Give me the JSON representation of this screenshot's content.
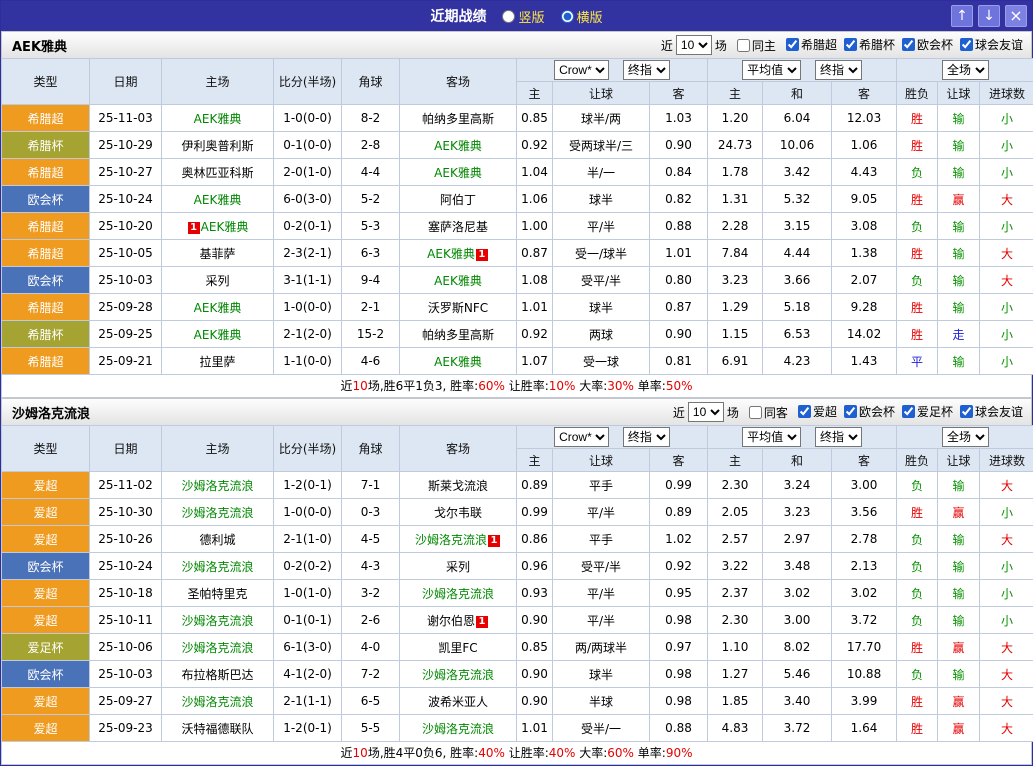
{
  "titlebar": {
    "title": "近期战绩",
    "radios": [
      {
        "label": "竖版",
        "checked": false
      },
      {
        "label": "横版",
        "checked": true
      }
    ],
    "buttons": [
      {
        "name": "up",
        "glyph": "↑"
      },
      {
        "name": "down",
        "glyph": "↓"
      },
      {
        "name": "close",
        "glyph": "×"
      }
    ]
  },
  "filter_labels": {
    "near": "近",
    "field": "场"
  },
  "table_header": {
    "type": "类型",
    "date": "日期",
    "home": "主场",
    "score": "比分(半场)",
    "corner": "角球",
    "away": "客场",
    "dd_crown": "Crow*",
    "dd_final1": "终指",
    "dd_avg": "平均值",
    "dd_final2": "终指",
    "dd_scope": "全场",
    "o1_home": "主",
    "o1_hcp": "让球",
    "o1_away": "客",
    "o2_home": "主",
    "o2_draw": "和",
    "o2_away": "客",
    "result": "胜负",
    "hcp": "让球",
    "goals": "进球数"
  },
  "league_colors": {
    "orange": "#ef9b1f",
    "olive": "#a5a433",
    "blue": "#4a72b8"
  },
  "result_colors": {
    "red": "#e60000",
    "green": "#089000",
    "blue": "#1d1dd8"
  },
  "sections": [
    {
      "team": "AEK雅典",
      "filter": {
        "count": "10",
        "same_label": "同主",
        "leagues": [
          "希腊超",
          "希腊杯",
          "欧会杯",
          "球会友谊"
        ]
      },
      "rows": [
        {
          "league": "希腊超",
          "lc": "orange",
          "date": "25-11-03",
          "home": "AEK雅典",
          "hg": true,
          "hb": "",
          "score": "1-0(0-0)",
          "corner": "8-2",
          "away": "帕纳多里高斯",
          "ag": false,
          "ab": "",
          "o": [
            "0.85",
            "球半/两",
            "1.03",
            "1.20",
            "6.04",
            "12.03"
          ],
          "res": [
            "胜",
            "red"
          ],
          "hcp": [
            "输",
            "green"
          ],
          "goal": [
            "小",
            "green"
          ]
        },
        {
          "league": "希腊杯",
          "lc": "olive",
          "date": "25-10-29",
          "home": "伊利奥普利斯",
          "hg": false,
          "hb": "",
          "score": "0-1(0-0)",
          "corner": "2-8",
          "away": "AEK雅典",
          "ag": true,
          "ab": "",
          "o": [
            "0.92",
            "受两球半/三",
            "0.90",
            "24.73",
            "10.06",
            "1.06"
          ],
          "res": [
            "胜",
            "red"
          ],
          "hcp": [
            "输",
            "green"
          ],
          "goal": [
            "小",
            "green"
          ]
        },
        {
          "league": "希腊超",
          "lc": "orange",
          "date": "25-10-27",
          "home": "奥林匹亚科斯",
          "hg": false,
          "hb": "",
          "score": "2-0(1-0)",
          "corner": "4-4",
          "away": "AEK雅典",
          "ag": true,
          "ab": "",
          "o": [
            "1.04",
            "半/一",
            "0.84",
            "1.78",
            "3.42",
            "4.43"
          ],
          "res": [
            "负",
            "green"
          ],
          "hcp": [
            "输",
            "green"
          ],
          "goal": [
            "小",
            "green"
          ]
        },
        {
          "league": "欧会杯",
          "lc": "blue",
          "date": "25-10-24",
          "home": "AEK雅典",
          "hg": true,
          "hb": "",
          "score": "6-0(3-0)",
          "corner": "5-2",
          "away": "阿伯丁",
          "ag": false,
          "ab": "",
          "o": [
            "1.06",
            "球半",
            "0.82",
            "1.31",
            "5.32",
            "9.05"
          ],
          "res": [
            "胜",
            "red"
          ],
          "hcp": [
            "赢",
            "red"
          ],
          "goal": [
            "大",
            "red"
          ]
        },
        {
          "league": "希腊超",
          "lc": "orange",
          "date": "25-10-20",
          "home": "AEK雅典",
          "hg": true,
          "hb": "pre",
          "score": "0-2(0-1)",
          "corner": "5-3",
          "away": "塞萨洛尼基",
          "ag": false,
          "ab": "",
          "o": [
            "1.00",
            "平/半",
            "0.88",
            "2.28",
            "3.15",
            "3.08"
          ],
          "res": [
            "负",
            "green"
          ],
          "hcp": [
            "输",
            "green"
          ],
          "goal": [
            "小",
            "green"
          ]
        },
        {
          "league": "希腊超",
          "lc": "orange",
          "date": "25-10-05",
          "home": "基菲萨",
          "hg": false,
          "hb": "",
          "score": "2-3(2-1)",
          "corner": "6-3",
          "away": "AEK雅典",
          "ag": true,
          "ab": "post",
          "o": [
            "0.87",
            "受一/球半",
            "1.01",
            "7.84",
            "4.44",
            "1.38"
          ],
          "res": [
            "胜",
            "red"
          ],
          "hcp": [
            "输",
            "green"
          ],
          "goal": [
            "大",
            "red"
          ]
        },
        {
          "league": "欧会杯",
          "lc": "blue",
          "date": "25-10-03",
          "home": "采列",
          "hg": false,
          "hb": "",
          "score": "3-1(1-1)",
          "corner": "9-4",
          "away": "AEK雅典",
          "ag": true,
          "ab": "",
          "o": [
            "1.08",
            "受平/半",
            "0.80",
            "3.23",
            "3.66",
            "2.07"
          ],
          "res": [
            "负",
            "green"
          ],
          "hcp": [
            "输",
            "green"
          ],
          "goal": [
            "大",
            "red"
          ]
        },
        {
          "league": "希腊超",
          "lc": "orange",
          "date": "25-09-28",
          "home": "AEK雅典",
          "hg": true,
          "hb": "",
          "score": "1-0(0-0)",
          "corner": "2-1",
          "away": "沃罗斯NFC",
          "ag": false,
          "ab": "",
          "o": [
            "1.01",
            "球半",
            "0.87",
            "1.29",
            "5.18",
            "9.28"
          ],
          "res": [
            "胜",
            "red"
          ],
          "hcp": [
            "输",
            "green"
          ],
          "goal": [
            "小",
            "green"
          ]
        },
        {
          "league": "希腊杯",
          "lc": "olive",
          "date": "25-09-25",
          "home": "AEK雅典",
          "hg": true,
          "hb": "",
          "score": "2-1(2-0)",
          "corner": "15-2",
          "away": "帕纳多里高斯",
          "ag": false,
          "ab": "",
          "o": [
            "0.92",
            "两球",
            "0.90",
            "1.15",
            "6.53",
            "14.02"
          ],
          "res": [
            "胜",
            "red"
          ],
          "hcp": [
            "走",
            "blue"
          ],
          "goal": [
            "小",
            "green"
          ]
        },
        {
          "league": "希腊超",
          "lc": "orange",
          "date": "25-09-21",
          "home": "拉里萨",
          "hg": false,
          "hb": "",
          "score": "1-1(0-0)",
          "corner": "4-6",
          "away": "AEK雅典",
          "ag": true,
          "ab": "",
          "o": [
            "1.07",
            "受一球",
            "0.81",
            "6.91",
            "4.23",
            "1.43"
          ],
          "res": [
            "平",
            "blue"
          ],
          "hcp": [
            "输",
            "green"
          ],
          "goal": [
            "小",
            "green"
          ]
        }
      ],
      "summary": [
        [
          "近",
          "b"
        ],
        [
          "10",
          "r"
        ],
        [
          "场,胜6平1负3, 胜率:",
          "b"
        ],
        [
          "60%",
          "r"
        ],
        [
          " 让胜率:",
          "b"
        ],
        [
          "10%",
          "r"
        ],
        [
          " 大率:",
          "b"
        ],
        [
          "30%",
          "r"
        ],
        [
          " 单率:",
          "b"
        ],
        [
          "50%",
          "r"
        ]
      ]
    },
    {
      "team": "沙姆洛克流浪",
      "filter": {
        "count": "10",
        "same_label": "同客",
        "leagues": [
          "爱超",
          "欧会杯",
          "爱足杯",
          "球会友谊"
        ]
      },
      "rows": [
        {
          "league": "爱超",
          "lc": "orange",
          "date": "25-11-02",
          "home": "沙姆洛克流浪",
          "hg": true,
          "hb": "",
          "score": "1-2(0-1)",
          "corner": "7-1",
          "away": "斯莱戈流浪",
          "ag": false,
          "ab": "",
          "o": [
            "0.89",
            "平手",
            "0.99",
            "2.30",
            "3.24",
            "3.00"
          ],
          "res": [
            "负",
            "green"
          ],
          "hcp": [
            "输",
            "green"
          ],
          "goal": [
            "大",
            "red"
          ]
        },
        {
          "league": "爱超",
          "lc": "orange",
          "date": "25-10-30",
          "home": "沙姆洛克流浪",
          "hg": true,
          "hb": "",
          "score": "1-0(0-0)",
          "corner": "0-3",
          "away": "戈尔韦联",
          "ag": false,
          "ab": "",
          "o": [
            "0.99",
            "平/半",
            "0.89",
            "2.05",
            "3.23",
            "3.56"
          ],
          "res": [
            "胜",
            "red"
          ],
          "hcp": [
            "赢",
            "red"
          ],
          "goal": [
            "小",
            "green"
          ]
        },
        {
          "league": "爱超",
          "lc": "orange",
          "date": "25-10-26",
          "home": "德利城",
          "hg": false,
          "hb": "",
          "score": "2-1(1-0)",
          "corner": "4-5",
          "away": "沙姆洛克流浪",
          "ag": true,
          "ab": "post",
          "o": [
            "0.86",
            "平手",
            "1.02",
            "2.57",
            "2.97",
            "2.78"
          ],
          "res": [
            "负",
            "green"
          ],
          "hcp": [
            "输",
            "green"
          ],
          "goal": [
            "大",
            "red"
          ]
        },
        {
          "league": "欧会杯",
          "lc": "blue",
          "date": "25-10-24",
          "home": "沙姆洛克流浪",
          "hg": true,
          "hb": "",
          "score": "0-2(0-2)",
          "corner": "4-3",
          "away": "采列",
          "ag": false,
          "ab": "",
          "o": [
            "0.96",
            "受平/半",
            "0.92",
            "3.22",
            "3.48",
            "2.13"
          ],
          "res": [
            "负",
            "green"
          ],
          "hcp": [
            "输",
            "green"
          ],
          "goal": [
            "小",
            "green"
          ]
        },
        {
          "league": "爱超",
          "lc": "orange",
          "date": "25-10-18",
          "home": "圣帕特里克",
          "hg": false,
          "hb": "",
          "score": "1-0(1-0)",
          "corner": "3-2",
          "away": "沙姆洛克流浪",
          "ag": true,
          "ab": "",
          "o": [
            "0.93",
            "平/半",
            "0.95",
            "2.37",
            "3.02",
            "3.02"
          ],
          "res": [
            "负",
            "green"
          ],
          "hcp": [
            "输",
            "green"
          ],
          "goal": [
            "小",
            "green"
          ]
        },
        {
          "league": "爱超",
          "lc": "orange",
          "date": "25-10-11",
          "home": "沙姆洛克流浪",
          "hg": true,
          "hb": "",
          "score": "0-1(0-1)",
          "corner": "2-6",
          "away": "谢尔伯恩",
          "ag": false,
          "ab": "post",
          "o": [
            "0.90",
            "平/半",
            "0.98",
            "2.30",
            "3.00",
            "3.72"
          ],
          "res": [
            "负",
            "green"
          ],
          "hcp": [
            "输",
            "green"
          ],
          "goal": [
            "小",
            "green"
          ]
        },
        {
          "league": "爱足杯",
          "lc": "olive",
          "date": "25-10-06",
          "home": "沙姆洛克流浪",
          "hg": true,
          "hb": "",
          "score": "6-1(3-0)",
          "corner": "4-0",
          "away": "凯里FC",
          "ag": false,
          "ab": "",
          "o": [
            "0.85",
            "两/两球半",
            "0.97",
            "1.10",
            "8.02",
            "17.70"
          ],
          "res": [
            "胜",
            "red"
          ],
          "hcp": [
            "赢",
            "red"
          ],
          "goal": [
            "大",
            "red"
          ]
        },
        {
          "league": "欧会杯",
          "lc": "blue",
          "date": "25-10-03",
          "home": "布拉格斯巴达",
          "hg": false,
          "hb": "",
          "score": "4-1(2-0)",
          "corner": "7-2",
          "away": "沙姆洛克流浪",
          "ag": true,
          "ab": "",
          "o": [
            "0.90",
            "球半",
            "0.98",
            "1.27",
            "5.46",
            "10.88"
          ],
          "res": [
            "负",
            "green"
          ],
          "hcp": [
            "输",
            "green"
          ],
          "goal": [
            "大",
            "red"
          ]
        },
        {
          "league": "爱超",
          "lc": "orange",
          "date": "25-09-27",
          "home": "沙姆洛克流浪",
          "hg": true,
          "hb": "",
          "score": "2-1(1-1)",
          "corner": "6-5",
          "away": "波希米亚人",
          "ag": false,
          "ab": "",
          "o": [
            "0.90",
            "半球",
            "0.98",
            "1.85",
            "3.40",
            "3.99"
          ],
          "res": [
            "胜",
            "red"
          ],
          "hcp": [
            "赢",
            "red"
          ],
          "goal": [
            "大",
            "red"
          ]
        },
        {
          "league": "爱超",
          "lc": "orange",
          "date": "25-09-23",
          "home": "沃特福德联队",
          "hg": false,
          "hb": "",
          "score": "1-2(0-1)",
          "corner": "5-5",
          "away": "沙姆洛克流浪",
          "ag": true,
          "ab": "",
          "o": [
            "1.01",
            "受半/一",
            "0.88",
            "4.83",
            "3.72",
            "1.64"
          ],
          "res": [
            "胜",
            "red"
          ],
          "hcp": [
            "赢",
            "red"
          ],
          "goal": [
            "大",
            "red"
          ]
        }
      ],
      "summary": [
        [
          "近",
          "b"
        ],
        [
          "10",
          "r"
        ],
        [
          "场,胜4平0负6, 胜率:",
          "b"
        ],
        [
          "40%",
          "r"
        ],
        [
          " 让胜率:",
          "b"
        ],
        [
          "40%",
          "r"
        ],
        [
          " 大率:",
          "b"
        ],
        [
          "60%",
          "r"
        ],
        [
          " 单率:",
          "b"
        ],
        [
          "90%",
          "r"
        ]
      ]
    }
  ]
}
